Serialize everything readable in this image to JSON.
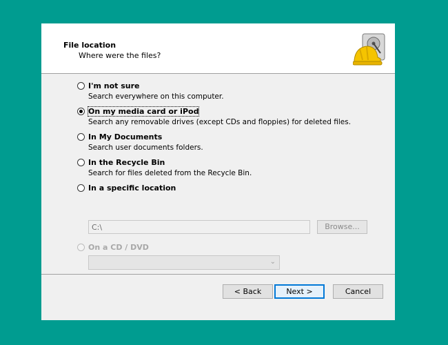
{
  "header": {
    "title": "File location",
    "subtitle": "Where were the files?",
    "icon": "hard-drive-hardhat-icon"
  },
  "options": [
    {
      "label": "I'm not sure",
      "description": "Search everywhere on this computer.",
      "selected": false,
      "enabled": true
    },
    {
      "label": "On my media card or iPod",
      "description": "Search any removable drives (except CDs and floppies) for deleted files.",
      "selected": true,
      "enabled": true
    },
    {
      "label": "In My Documents",
      "description": "Search user documents folders.",
      "selected": false,
      "enabled": true
    },
    {
      "label": "In the Recycle Bin",
      "description": "Search for files deleted from the Recycle Bin.",
      "selected": false,
      "enabled": true
    },
    {
      "label": "In a specific location",
      "selected": false,
      "enabled": true
    },
    {
      "label": "On a CD / DVD",
      "selected": false,
      "enabled": false
    }
  ],
  "location": {
    "path_value": "C:\\",
    "browse_label": "Browse..."
  },
  "cd_dvd": {
    "selected_value": ""
  },
  "buttons": {
    "back": "< Back",
    "next": "Next >",
    "cancel": "Cancel"
  },
  "colors": {
    "background": "#009c90",
    "dialog_body": "#f0f0f0",
    "default_button_border": "#0078d7"
  }
}
